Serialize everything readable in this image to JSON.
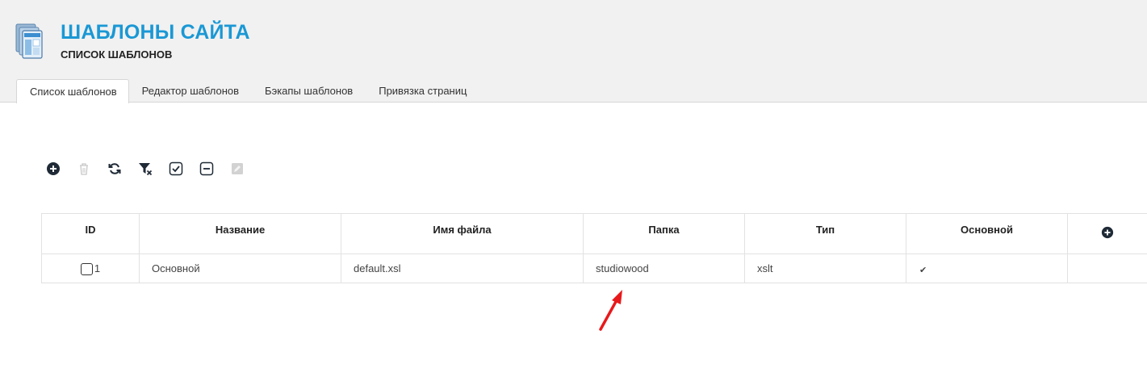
{
  "header": {
    "title": "ШАБЛОНЫ САЙТА",
    "subtitle": "СПИСОК ШАБЛОНОВ",
    "icon": "templates-icon"
  },
  "tabs": [
    {
      "label": "Список шаблонов",
      "active": true
    },
    {
      "label": "Редактор шаблонов",
      "active": false
    },
    {
      "label": "Бэкапы шаблонов",
      "active": false
    },
    {
      "label": "Привязка страниц",
      "active": false
    }
  ],
  "toolbar": {
    "buttons": [
      {
        "icon": "add-circle-icon",
        "enabled": true
      },
      {
        "icon": "trash-icon",
        "enabled": false
      },
      {
        "icon": "refresh-icon",
        "enabled": true
      },
      {
        "icon": "clear-filter-icon",
        "enabled": true
      },
      {
        "icon": "check-all-icon",
        "enabled": true
      },
      {
        "icon": "uncheck-all-icon",
        "enabled": true
      },
      {
        "icon": "edit-icon",
        "enabled": false
      }
    ]
  },
  "table": {
    "columns": [
      "ID",
      "Название",
      "Имя файла",
      "Папка",
      "Тип",
      "Основной"
    ],
    "rows": [
      {
        "id": "1",
        "name": "Основной",
        "filename": "default.xsl",
        "folder": "studiowood",
        "type": "xslt",
        "main": "✔"
      }
    ]
  },
  "colors": {
    "accent": "#1a98d5",
    "header_bg": "#f1f1f1",
    "annotation_arrow": "#e8191b"
  }
}
